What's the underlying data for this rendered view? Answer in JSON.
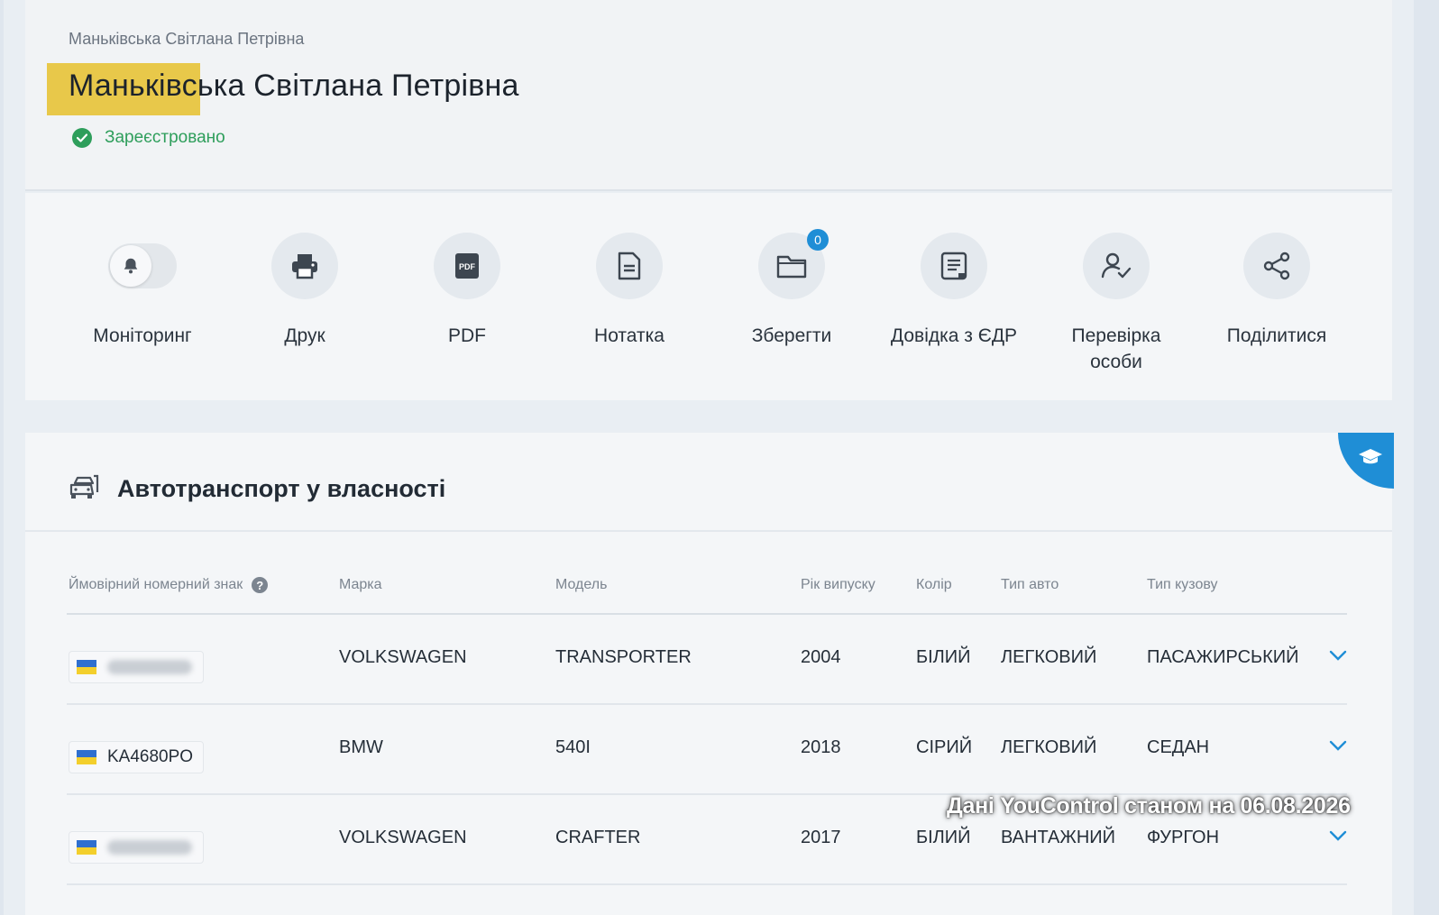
{
  "header": {
    "breadcrumb": "Маньківська Світлана Петрівна",
    "title": "Маньківська Світлана Петрівна",
    "status": "Зареєстровано"
  },
  "actions": [
    {
      "label": "Моніторинг",
      "icon": "bell-icon"
    },
    {
      "label": "Друк",
      "icon": "printer-icon"
    },
    {
      "label": "PDF",
      "icon": "pdf-icon"
    },
    {
      "label": "Нотатка",
      "icon": "note-icon"
    },
    {
      "label": "Зберегти",
      "icon": "folder-icon",
      "badge": "0"
    },
    {
      "label": "Довідка з ЄДР",
      "icon": "document-icon"
    },
    {
      "label": "Перевірка особи",
      "icon": "person-check-icon"
    },
    {
      "label": "Поділитися",
      "icon": "share-icon"
    }
  ],
  "transport": {
    "title": "Автотранспорт у власності",
    "columns": [
      "Ймовірний номерний знак",
      "Марка",
      "Модель",
      "Рік випуску",
      "Колір",
      "Тип авто",
      "Тип кузову"
    ],
    "rows": [
      {
        "plate": "",
        "plate_hidden": true,
        "brand": "VOLKSWAGEN",
        "model": "TRANSPORTER",
        "year": "2004",
        "color": "БІЛИЙ",
        "type": "ЛЕГКОВИЙ",
        "body": "ПАСАЖИРСЬКИЙ"
      },
      {
        "plate": "KA4680PO",
        "plate_hidden": false,
        "brand": "BMW",
        "model": "540I",
        "year": "2018",
        "color": "СІРИЙ",
        "type": "ЛЕГКОВИЙ",
        "body": "СЕДАН"
      },
      {
        "plate": "",
        "plate_hidden": true,
        "brand": "VOLKSWAGEN",
        "model": "CRAFTER",
        "year": "2017",
        "color": "БІЛИЙ",
        "type": "ВАНТАЖНИЙ",
        "body": "ФУРГОН"
      }
    ]
  },
  "watermark": "Дані YouControl станом на 06.08.2026",
  "colors": {
    "accent": "#1f8ed6",
    "success": "#2e9e5b",
    "highlight": "#e8c84a"
  }
}
